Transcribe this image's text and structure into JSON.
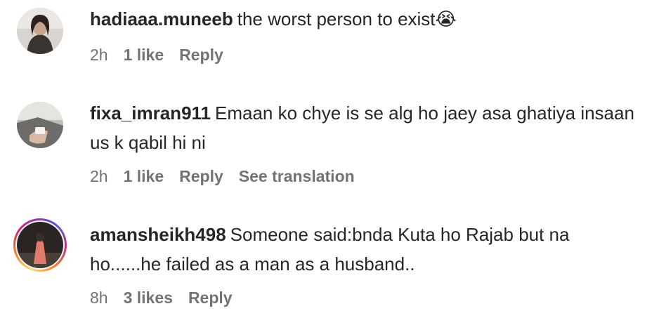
{
  "comments": [
    {
      "username": "hadiaaa.muneeb",
      "text": "the worst person to exist",
      "emoji": "😭",
      "time": "2h",
      "likes": "1 like",
      "reply": "Reply",
      "translation": ""
    },
    {
      "username": "fixa_imran911",
      "text": "Emaan ko chye is se alg ho jaey asa ghatiya insaan us k qabil hi ni",
      "emoji": "",
      "time": "2h",
      "likes": "1 like",
      "reply": "Reply",
      "translation": "See translation"
    },
    {
      "username": "amansheikh498",
      "text": "Someone said:bnda Kuta ho Rajab but na ho......he failed as a man as a husband..",
      "emoji": "",
      "time": "8h",
      "likes": "3 likes",
      "reply": "Reply",
      "translation": ""
    }
  ],
  "colors": {
    "text": "#262626",
    "meta": "#737373",
    "story_ring": "#d62976"
  }
}
